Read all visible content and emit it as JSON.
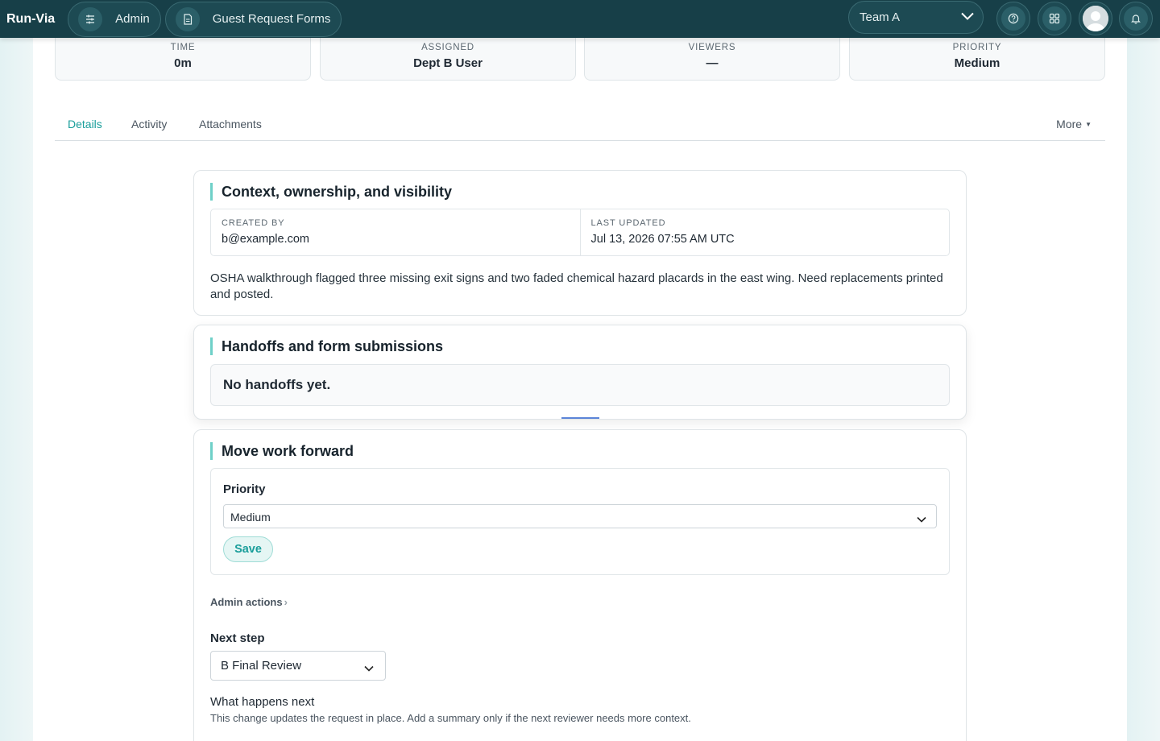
{
  "nav": {
    "brand": "Run-Via",
    "admin_label": "Admin",
    "forms_label": "Guest Request Forms",
    "team_label": "Team A"
  },
  "stats": [
    {
      "label": "TIME",
      "value": "0m"
    },
    {
      "label": "ASSIGNED",
      "value": "Dept B User"
    },
    {
      "label": "VIEWERS",
      "value": "—"
    },
    {
      "label": "PRIORITY",
      "value": "Medium"
    }
  ],
  "tabs": {
    "details": "Details",
    "activity": "Activity",
    "attachments": "Attachments",
    "more": "More"
  },
  "context": {
    "title": "Context, ownership, and visibility",
    "created_by_label": "CREATED BY",
    "created_by_value": "b@example.com",
    "last_updated_label": "LAST UPDATED",
    "last_updated_value": "Jul 13, 2026 07:55 AM UTC",
    "description": "OSHA walkthrough flagged three missing exit signs and two faded chemical hazard placards in the east wing. Need replacements printed and posted."
  },
  "handoffs": {
    "title": "Handoffs and form submissions",
    "empty": "No handoffs yet."
  },
  "move": {
    "title": "Move work forward",
    "priority_label": "Priority",
    "priority_value": "Medium",
    "save_label": "Save",
    "admin_actions": "Admin actions",
    "next_step_label": "Next step",
    "next_step_value": "B Final Review",
    "what_next_title": "What happens next",
    "what_next_text": "This change updates the request in place. Add a summary only if the next reviewer needs more context."
  },
  "colors": {
    "navbar": "#173f48",
    "accent": "#1a9e9b",
    "title_bar": "#6fd0c8"
  }
}
